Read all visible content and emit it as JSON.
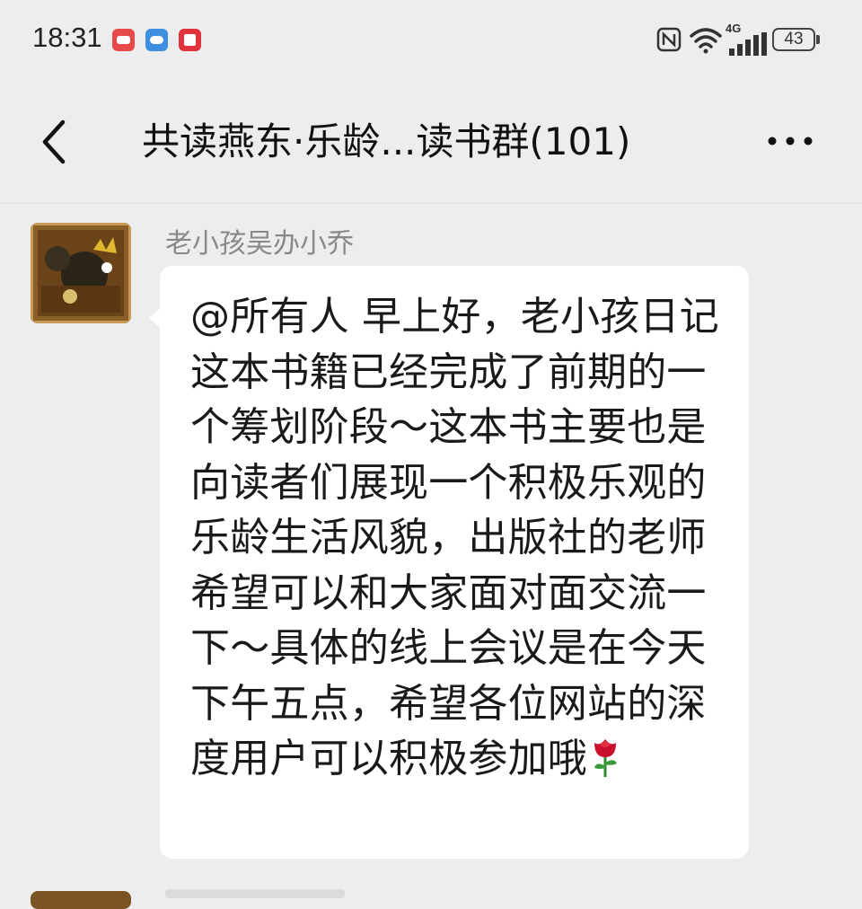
{
  "status_bar": {
    "time": "18:31",
    "network_label": "4G",
    "battery_level": "43",
    "icons": [
      "app-notification-icon",
      "game-controller-icon",
      "book-app-icon",
      "nfc-icon",
      "wifi-icon",
      "signal-icon",
      "battery-icon"
    ]
  },
  "header": {
    "title": "共读燕东·乐龄...读书群(101)",
    "back_icon": "chevron-left-icon",
    "more_icon": "more-dots-icon"
  },
  "messages": [
    {
      "sender": "老小孩吴办小乔",
      "text": "@所有人  早上好，老小孩日记这本书籍已经完成了前期的一个筹划阶段～这本书主要也是向读者们展现一个积极乐观的乐龄生活风貌，出版社的老师希望可以和大家面对面交流一下～具体的线上会议是在今天下午五点，希望各位网站的深度用户可以积极参加哦",
      "emoji": "rose-icon"
    }
  ],
  "colors": {
    "background": "#ededed",
    "bubble": "#ffffff",
    "sender_name": "#888888",
    "text": "#1a1a1a"
  }
}
